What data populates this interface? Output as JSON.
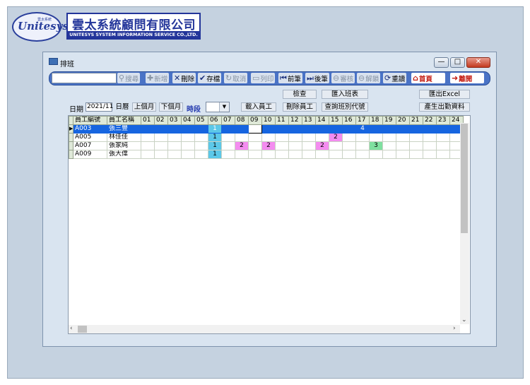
{
  "logo": {
    "oval_text": "Unitesys",
    "oval_small": "雲太系統"
  },
  "company": {
    "name_zh": "雲太系統顧問有限公司",
    "name_en": "UNITESYS SYSTEM INFORMATION SERVICE CO.,LTD."
  },
  "window": {
    "title": "排班",
    "minimize": "—",
    "maximize": "□",
    "close": "✕"
  },
  "toolbar": {
    "search_value": "",
    "search": "搜尋",
    "add": "新增",
    "delete": "刪除",
    "save": "存檔",
    "cancel": "取消",
    "print": "列印",
    "prev": "前筆",
    "next": "後筆",
    "audit": "審核",
    "unlock": "解鎖",
    "reload": "重讀",
    "home": "首頁",
    "leave": "離開"
  },
  "controls": {
    "check": "檢查",
    "import_schedule": "匯入班表",
    "export_excel": "匯出Excel",
    "date_label": "日期",
    "date_value": "2021/11",
    "calendar": "日曆",
    "prev_month": "上個月",
    "next_month": "下個月",
    "period_label": "時段",
    "load_staff": "載入員工",
    "delete_staff": "刪除員工",
    "query_shift": "查詢班別代號",
    "gen_attendance": "產生出勤資料"
  },
  "grid": {
    "headers": [
      "員工編號",
      "員工名稱",
      "01",
      "02",
      "03",
      "04",
      "05",
      "06",
      "07",
      "08",
      "09",
      "10",
      "11",
      "12",
      "13",
      "14",
      "15",
      "16",
      "17",
      "18",
      "19",
      "20",
      "21",
      "22",
      "23",
      "24"
    ],
    "rows": [
      {
        "id": "A003",
        "name": "張三豐",
        "cells": {
          "06": "1",
          "17": "4"
        },
        "selected": true
      },
      {
        "id": "A005",
        "name": "林佳佳",
        "cells": {
          "06": "1",
          "15": "2"
        }
      },
      {
        "id": "A007",
        "name": "張家純",
        "cells": {
          "06": "1",
          "08": "2",
          "10": "2",
          "14": "2",
          "18": "3"
        }
      },
      {
        "id": "A009",
        "name": "張大偉",
        "cells": {
          "06": "1"
        }
      }
    ]
  },
  "colors": {
    "shift_1": "#5cc8e8",
    "shift_2": "#f48cf0",
    "shift_3": "#7fe0a0",
    "selected_row": "#1665e0",
    "toolbar": "#4a73c6"
  }
}
